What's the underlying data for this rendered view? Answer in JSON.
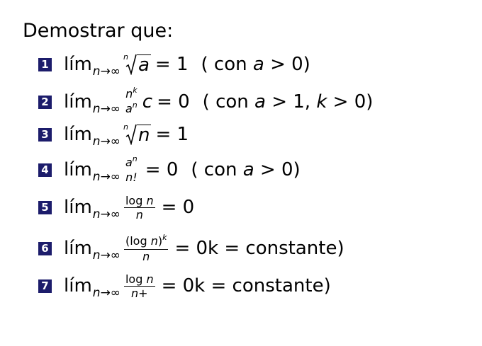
{
  "title": "Demostrar que:",
  "items": [
    {
      "num": "1",
      "lim": "lím",
      "sub_n": "n",
      "sub_arrow": "→∞",
      "root_index": "n",
      "radicand": "a",
      "rhs": "= 1",
      "cond_open": "( con",
      "cond_var": "a",
      "cond_rest": "> 0)"
    },
    {
      "num": "2",
      "lim": "lím",
      "sub_n": "n",
      "sub_arrow": "→∞",
      "frac_num_base": "n",
      "frac_num_sup": "k",
      "frac_den_base": "a",
      "frac_den_sup": "n",
      "factor": "c",
      "rhs": "= 0",
      "cond_open": "( con",
      "cond_var": "a",
      "cond_mid": "> 1,",
      "cond_var2": "k",
      "cond_rest": "> 0)"
    },
    {
      "num": "3",
      "lim": "lím",
      "sub_n": "n",
      "sub_arrow": "→∞",
      "root_index": "n",
      "radicand": "n",
      "rhs": "= 1"
    },
    {
      "num": "4",
      "lim": "lím",
      "sub_n": "n",
      "sub_arrow": "→∞",
      "frac_num_base": "a",
      "frac_num_sup": "n",
      "frac_den": "n!",
      "rhs": "= 0",
      "cond_open": "( con",
      "cond_var": "a",
      "cond_rest": "> 0)"
    },
    {
      "num": "5",
      "lim": "lím",
      "sub_n": "n",
      "sub_arrow": "→∞",
      "frac_num_log": "log",
      "frac_num_var": "n",
      "frac_den": "n",
      "rhs": "= 0"
    },
    {
      "num": "6",
      "lim": "lím",
      "sub_n": "n",
      "sub_arrow": "→∞",
      "frac_num_open": "(log",
      "frac_num_var": "n",
      "frac_num_close": ")",
      "frac_num_sup": "k",
      "frac_den": "n",
      "rhs": "= 0k = constante)"
    },
    {
      "num": "7",
      "lim": "lím",
      "sub_n": "n",
      "sub_arrow": "→∞",
      "frac_num_log": "log",
      "frac_num_var": "n",
      "frac_den": "n+",
      "rhs": "= 0k = constante)"
    }
  ]
}
